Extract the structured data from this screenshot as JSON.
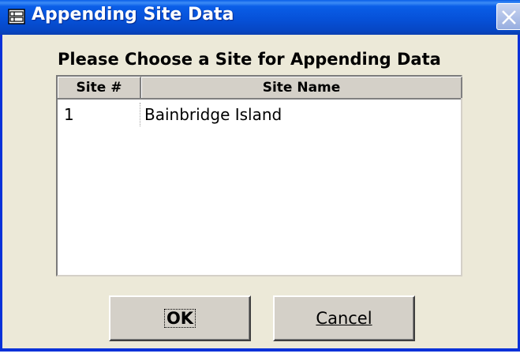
{
  "window": {
    "title": "Appending Site Data",
    "icon": "form-icon",
    "close_icon": "close-icon"
  },
  "dialog": {
    "heading": "Please Choose a Site for Appending Data"
  },
  "list": {
    "columns": [
      "Site #",
      "Site Name"
    ],
    "rows": [
      {
        "site_num": "1",
        "site_name": "Bainbridge Island"
      }
    ]
  },
  "buttons": {
    "ok_label": "OK",
    "cancel_label": "Cancel"
  },
  "colors": {
    "titlebar": "#0651d8",
    "dialog_bg": "#ece9d8",
    "frame": "#0831d9"
  }
}
